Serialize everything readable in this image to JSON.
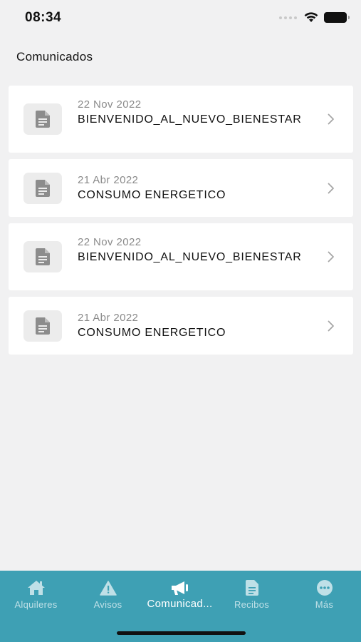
{
  "status": {
    "time": "08:34"
  },
  "page": {
    "title": "Comunicados"
  },
  "items": [
    {
      "date": "22 Nov 2022",
      "title": "BIENVENIDO_AL_NUEVO_BIENESTAR",
      "icon": "document-icon"
    },
    {
      "date": "21 Abr 2022",
      "title": "CONSUMO ENERGETICO",
      "icon": "document-icon"
    },
    {
      "date": "22 Nov 2022",
      "title": "BIENVENIDO_AL_NUEVO_BIENESTAR",
      "icon": "document-icon"
    },
    {
      "date": "21 Abr 2022",
      "title": "CONSUMO ENERGETICO",
      "icon": "document-icon"
    }
  ],
  "tabbar": {
    "tabs": [
      {
        "label": "Alquileres",
        "icon": "home-icon",
        "active": false
      },
      {
        "label": "Avisos",
        "icon": "warning-icon",
        "active": false
      },
      {
        "label": "Comunicad...",
        "icon": "megaphone-icon",
        "active": true
      },
      {
        "label": "Recibos",
        "icon": "receipt-icon",
        "active": false
      },
      {
        "label": "Más",
        "icon": "more-icon",
        "active": false
      }
    ]
  },
  "colors": {
    "background": "#f1f1f2",
    "card": "#ffffff",
    "tabbar": "#3ea0b4",
    "tab_inactive": "#bfe0e7",
    "tab_active": "#ffffff",
    "date_text": "#8a8a8a"
  }
}
